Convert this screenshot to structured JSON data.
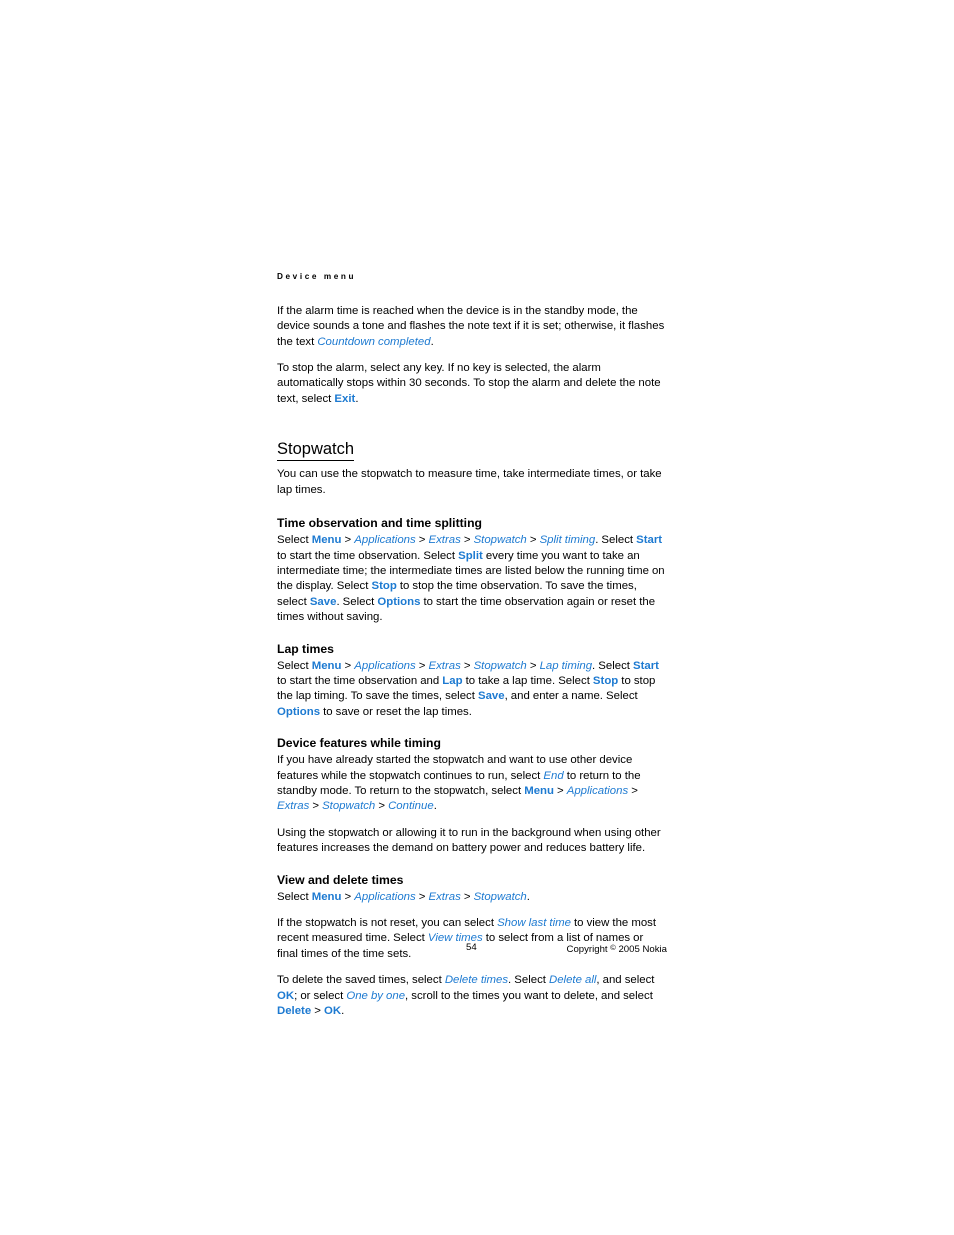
{
  "document": {
    "running_header": "Device menu",
    "page_number": "54",
    "copyright_prefix": "Copyright ",
    "copyright_symbol": "©",
    "copyright_suffix": " 2005 Nokia"
  },
  "colors": {
    "link_blue": "#1d7ad1",
    "text_black": "#000000",
    "page_background": "#ffffff"
  },
  "intro": {
    "paragraph_1": {
      "text_before_note": "If the alarm time is reached when the device is in the standby mode, the device sounds a tone and flashes the note text if it is set; otherwise, it flashes the text ",
      "note": "Countdown completed",
      "text_after_note": "."
    },
    "paragraph_2": {
      "text_before_cmd": "To stop the alarm, select any key. If no key is selected, the alarm automatically stops within 30 seconds. To stop the alarm and delete the note text, select ",
      "cmd": "Exit",
      "text_after_cmd": "."
    }
  },
  "chapter": {
    "title": "Stopwatch",
    "intro": "You can use the stopwatch to measure time, take intermediate times, or take lap times."
  },
  "sections": {
    "time_observation": {
      "heading": "Time observation and time splitting",
      "s1": "Select ",
      "menu": "Menu",
      "sep1": " > ",
      "applications": "Applications",
      "sep2": " > ",
      "extras": "Extras",
      "sep3": " > ",
      "stopwatch": "Stopwatch",
      "sep4": " > ",
      "split_timing": "Split timing",
      "s2": ". Select ",
      "start": "Start",
      "s3": " to start the time observation. Select ",
      "split": "Split",
      "s4": " every time you want to take an intermediate time; the intermediate times are listed below the running time on the display. Select ",
      "stop": "Stop",
      "s5": " to stop the time observation. To save the times, select ",
      "save": "Save",
      "s6": ". Select ",
      "options": "Options",
      "s7": " to start the time observation again or reset the times without saving."
    },
    "lap_times": {
      "heading": "Lap times",
      "s1": "Select ",
      "menu": "Menu",
      "sep1": " > ",
      "applications": "Applications",
      "sep2": " > ",
      "extras": "Extras",
      "sep3": " > ",
      "stopwatch": "Stopwatch",
      "sep4": " > ",
      "lap_timing": "Lap timing",
      "s2": ". Select ",
      "start": "Start",
      "s3": " to start the time observation and ",
      "lap": "Lap",
      "s4": " to take a lap time. Select ",
      "stop": "Stop",
      "s5": " to stop the lap timing. To save the times, select ",
      "save": "Save",
      "s6": ", and enter a name. Select ",
      "options": "Options",
      "s7": " to save or reset the lap times."
    },
    "device_features": {
      "heading": "Device features while timing",
      "p1_s1": "If you have already started the stopwatch and want to use other device features while the stopwatch continues to run, select ",
      "p1_end": "End",
      "p1_s2": " to return to the standby mode. To return to the stopwatch, select ",
      "menu": "Menu",
      "sep1": " > ",
      "applications": "Applications",
      "sep2": " > ",
      "extras": "Extras",
      "sep3": " > ",
      "stopwatch": "Stopwatch",
      "sep4": " > ",
      "continue": "Continue",
      "p1_s3": ".",
      "p2": "Using the stopwatch or allowing it to run in the background when using other features increases the demand on battery power and reduces battery life."
    },
    "view_delete": {
      "heading": "View and delete times",
      "p1_s1": "Select ",
      "menu": "Menu",
      "sep1": " > ",
      "applications": "Applications",
      "sep2": " > ",
      "extras": "Extras",
      "sep3": " > ",
      "stopwatch": "Stopwatch",
      "p1_s2": ".",
      "p2_s1": "If the stopwatch is not reset, you can select ",
      "show_last_time": "Show last time",
      "p2_s2": " to view the most recent measured time. Select ",
      "view_times": "View times",
      "p2_s3": " to select from a list of names or final times of the time sets.",
      "p3_s1": "To delete the saved times, select ",
      "delete_times": "Delete times",
      "p3_s2": ". Select ",
      "delete_all": "Delete all",
      "p3_s3": ", and select ",
      "ok1": "OK",
      "p3_s4": "; or select ",
      "one_by_one": "One by one",
      "p3_s5": ", scroll to the times you want to delete, and select ",
      "delete": "Delete",
      "p3_sep": " > ",
      "ok2": "OK",
      "p3_s6": "."
    }
  }
}
